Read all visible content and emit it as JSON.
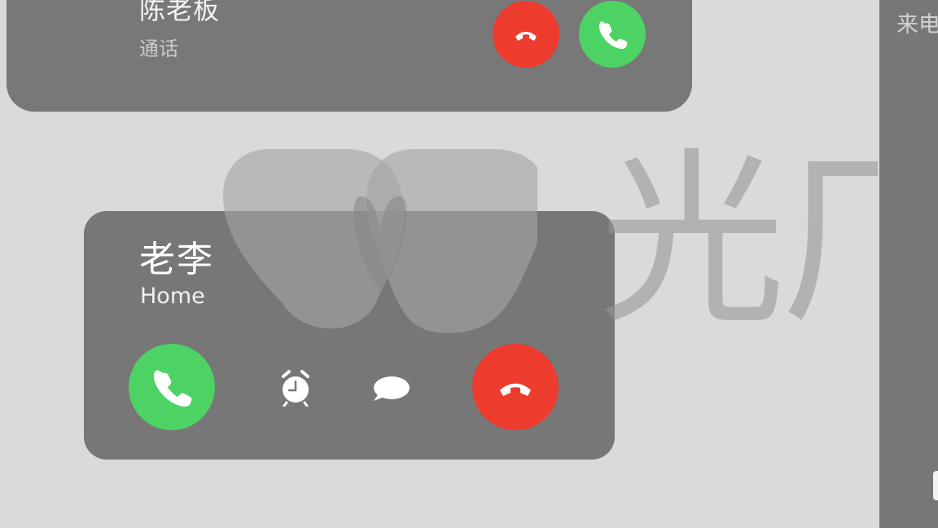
{
  "top_call": {
    "caller": "陈老板",
    "subtitle": "通话",
    "decline_icon": "phone-hangup-icon",
    "accept_icon": "phone-icon",
    "colors": {
      "card": "#787878",
      "decline": "#ed3b2d",
      "accept": "#4cd364"
    }
  },
  "main_call": {
    "caller": "老李",
    "subtitle": "Home",
    "accept_icon": "phone-icon",
    "remind_icon": "alarm-clock-icon",
    "message_icon": "message-bubble-icon",
    "decline_icon": "phone-hangup-icon",
    "colors": {
      "card": "#777777",
      "decline": "#ed3b2d",
      "accept": "#4cd364"
    }
  },
  "right_panel": {
    "title": "来电"
  },
  "watermark": {
    "text": "光厂"
  }
}
